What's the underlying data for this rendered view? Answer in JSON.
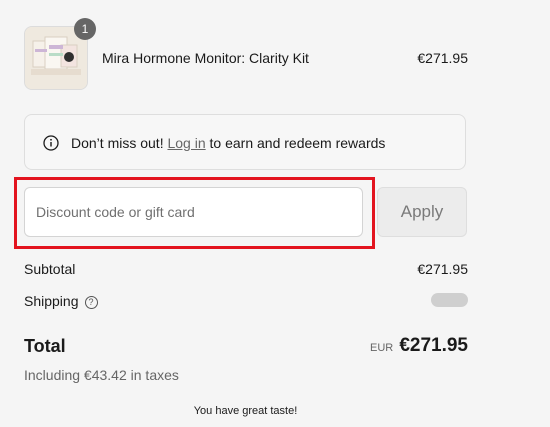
{
  "product": {
    "quantity": "1",
    "name": "Mira Hormone Monitor: Clarity Kit",
    "price": "€271.95"
  },
  "rewards": {
    "lead": "Don’t miss out!",
    "link": "Log in",
    "tail": "to earn and redeem rewards",
    "icon": "info-icon"
  },
  "discount": {
    "placeholder": "Discount code or gift card",
    "value": "",
    "apply_label": "Apply"
  },
  "summary": {
    "subtotal_label": "Subtotal",
    "subtotal_value": "€271.95",
    "shipping_label": "Shipping",
    "shipping_icon": "help-circle-icon"
  },
  "total": {
    "label": "Total",
    "currency": "EUR",
    "amount": "€271.95",
    "taxes": "Including €43.42 in taxes"
  },
  "footer": {
    "note": "You have great taste!"
  },
  "colors": {
    "highlight": "#e3141f",
    "background": "#f5f5f5"
  }
}
